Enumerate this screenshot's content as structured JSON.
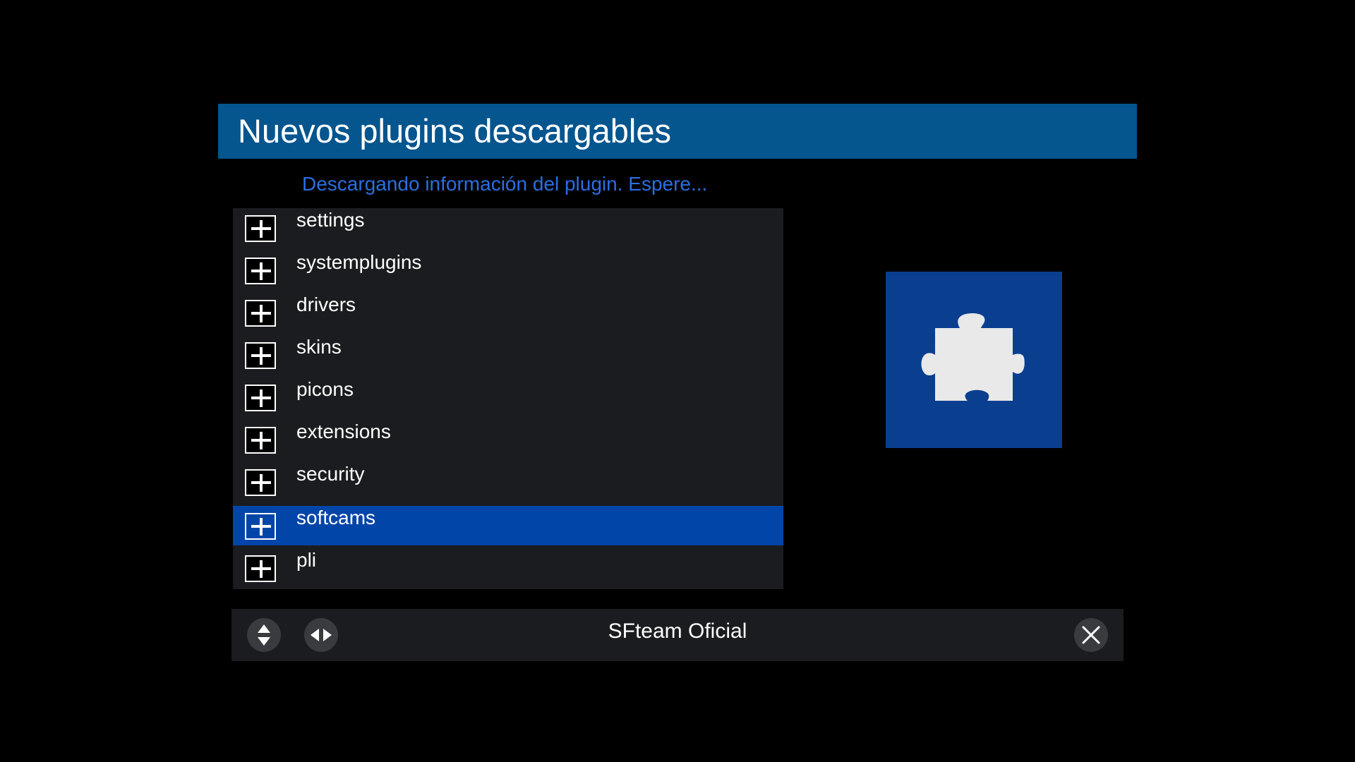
{
  "header": {
    "title": "Nuevos plugins descargables"
  },
  "status": {
    "message": "Descargando información del plugin. Espere..."
  },
  "plugin_list": {
    "items": [
      {
        "label": "settings",
        "icon": "plus-icon"
      },
      {
        "label": "systemplugins",
        "icon": "plus-icon"
      },
      {
        "label": "drivers",
        "icon": "plus-icon"
      },
      {
        "label": "skins",
        "icon": "plus-icon"
      },
      {
        "label": "picons",
        "icon": "plus-icon"
      },
      {
        "label": "extensions",
        "icon": "plus-icon"
      },
      {
        "label": "security",
        "icon": "plus-icon"
      },
      {
        "label": "softcams",
        "icon": "plus-icon"
      },
      {
        "label": "pli",
        "icon": "plus-icon"
      }
    ],
    "selected_label": "softcams"
  },
  "preview": {
    "icon": "puzzle-piece-icon"
  },
  "footer": {
    "text": "SFteam Oficial",
    "buttons": [
      {
        "icon": "up-down-arrows-icon"
      },
      {
        "icon": "left-right-arrows-icon"
      },
      {
        "icon": "close-icon"
      }
    ]
  },
  "colors": {
    "title_bar": "#05558e",
    "status_text": "#2a6fe0",
    "selected_row": "#0245a8",
    "preview_bg": "#0a3f8f",
    "panel_bg": "#1b1c1f",
    "background": "#000000"
  }
}
